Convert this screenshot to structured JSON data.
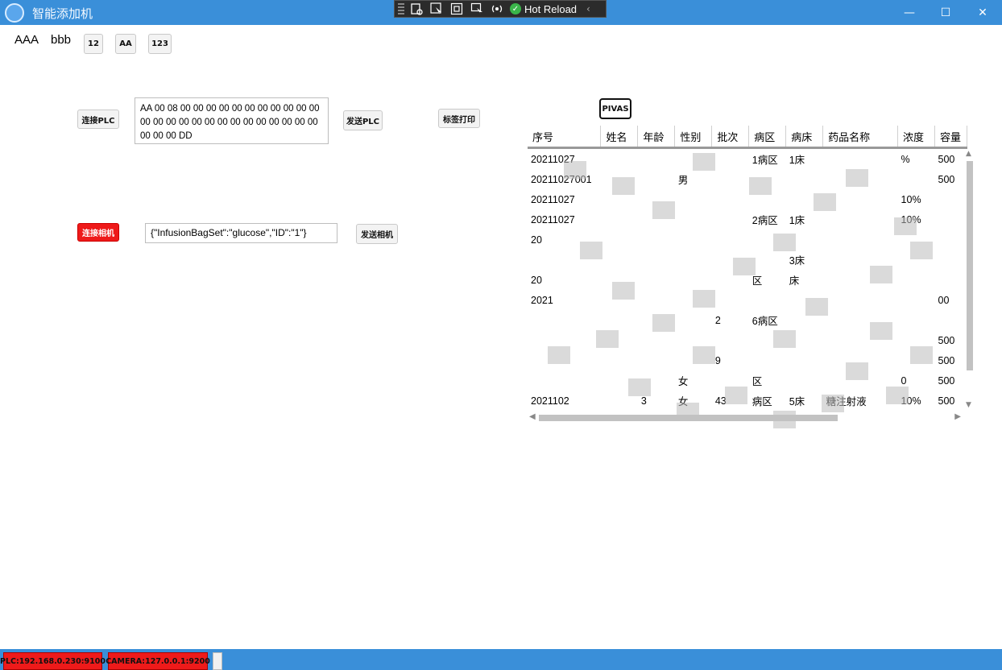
{
  "window": {
    "title": "智能添加机",
    "minimize": "—",
    "maximize": "☐",
    "close": "✕"
  },
  "hot_reload": {
    "label": "Hot Reload"
  },
  "top": {
    "label_a": "AAA",
    "label_b": "bbb",
    "btn1": "12",
    "btn2": "AA",
    "btn3": "123"
  },
  "plc": {
    "connect_label": "连接PLC",
    "data": "AA 00 08 00 00 00 00 00 00 00 00 00 00 00 00 00 00 00 00 00 00 00 00 00 00 00 00 00 00 00 00 DD",
    "send_label": "发送PLC"
  },
  "print_label": "标签打印",
  "camera": {
    "connect_label": "连接相机",
    "input_value": "{\"InfusionBagSet\":\"glucose\",\"ID\":\"1\"}",
    "send_label": "发送相机"
  },
  "pivas_label": "PIVAS",
  "grid": {
    "columns": [
      "序号",
      "姓名",
      "年龄",
      "性别",
      "批次",
      "病区",
      "病床",
      "药品名称",
      "浓度",
      "容量"
    ],
    "rows": [
      [
        "20211027",
        "",
        "",
        "",
        "",
        "1病区",
        "1床",
        "",
        "%",
        "500"
      ],
      [
        "20211027001",
        "",
        "",
        "男",
        "",
        "",
        "",
        "",
        "",
        "500"
      ],
      [
        "20211027",
        "",
        "",
        "",
        "",
        "",
        "",
        "",
        "10%",
        ""
      ],
      [
        "20211027",
        "",
        "",
        "",
        "",
        "2病区",
        "1床",
        "",
        "10%",
        ""
      ],
      [
        "20",
        "",
        "",
        "",
        "",
        "",
        "",
        "",
        "",
        ""
      ],
      [
        "",
        "",
        "",
        "",
        "",
        "",
        "3床",
        "",
        "",
        ""
      ],
      [
        "20",
        "",
        "",
        "",
        "",
        "区",
        "床",
        "",
        "",
        ""
      ],
      [
        "2021",
        "",
        "",
        "",
        "",
        "",
        "",
        "",
        "",
        "00"
      ],
      [
        "",
        "",
        "",
        "",
        "2",
        "6病区",
        "",
        "",
        "",
        ""
      ],
      [
        "",
        "",
        "",
        "",
        "",
        "",
        "",
        "",
        "",
        "500"
      ],
      [
        "",
        "",
        "",
        "",
        "9",
        "",
        "",
        "",
        "",
        "500"
      ],
      [
        "",
        "",
        "",
        "女",
        "",
        "区",
        "",
        "",
        "0",
        "500"
      ],
      [
        "2021102",
        "",
        "3",
        "女",
        "43",
        "病区",
        "5床",
        "糖注射液",
        "10%",
        "500"
      ]
    ]
  },
  "status": {
    "plc": "PLC:192.168.0.230:9100",
    "camera": "CAMERA:127.0.0.1:9200"
  },
  "colors": {
    "titlebar": "#3a8fd9",
    "alert_red": "#ee1a1a"
  }
}
